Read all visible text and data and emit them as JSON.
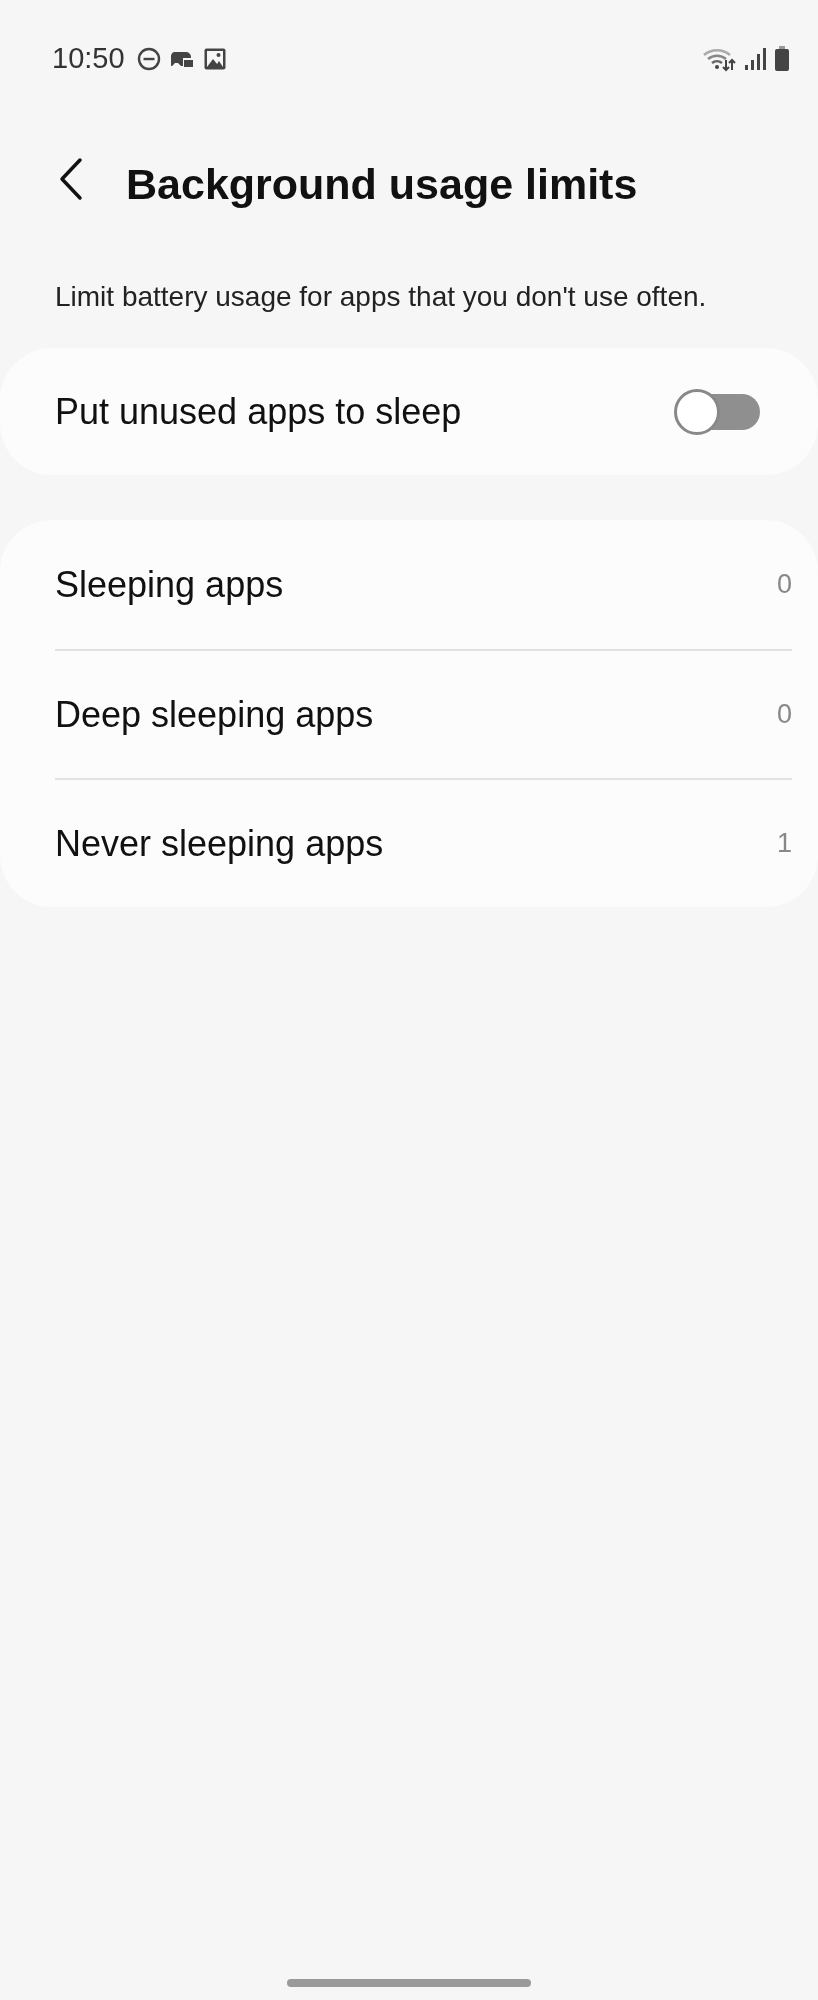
{
  "status_bar": {
    "time": "10:50"
  },
  "header": {
    "title": "Background usage limits"
  },
  "description": "Limit battery usage for apps that you don't use often.",
  "toggle_setting": {
    "label": "Put unused apps to sleep",
    "on": false
  },
  "items": [
    {
      "label": "Sleeping apps",
      "count": "0"
    },
    {
      "label": "Deep sleeping apps",
      "count": "0"
    },
    {
      "label": "Never sleeping apps",
      "count": "1"
    }
  ]
}
